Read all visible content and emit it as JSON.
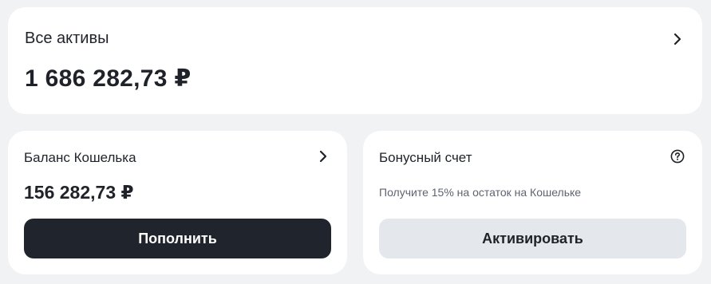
{
  "total_assets": {
    "title": "Все активы",
    "amount": "1 686 282,73 ₽",
    "arrow_icon": "chevron-right-icon"
  },
  "wallet": {
    "title": "Баланс Кошелька",
    "amount": "156 282,73 ₽",
    "arrow_icon": "chevron-right-icon",
    "button_label": "Пополнить"
  },
  "bonus": {
    "title": "Бонусный счет",
    "help_icon": "question-circle-icon",
    "subtitle": "Получите 15% на остаток на Кошельке",
    "button_label": "Активировать"
  },
  "colors": {
    "background": "#f1f2f4",
    "card": "#ffffff",
    "primary_button": "#20242c",
    "secondary_button": "#e4e7ec",
    "text": "#1f2329",
    "muted_text": "#5e6470"
  }
}
